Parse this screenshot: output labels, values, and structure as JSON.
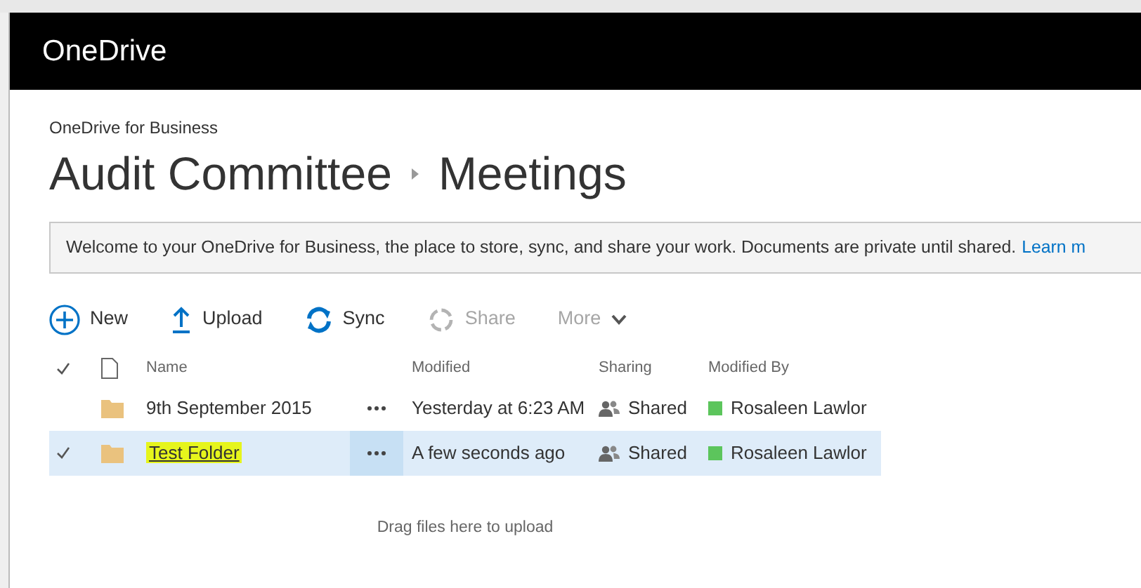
{
  "app": {
    "title": "OneDrive"
  },
  "breadcrumb": {
    "site": "OneDrive for Business",
    "path": [
      "Audit Committee",
      "Meetings"
    ]
  },
  "banner": {
    "text": "Welcome to your OneDrive for Business, the place to store, sync, and share your work. Documents are private until shared.",
    "link": "Learn m"
  },
  "toolbar": [
    {
      "kind": "new",
      "label": "New",
      "disabled": false
    },
    {
      "kind": "upload",
      "label": "Upload",
      "disabled": false
    },
    {
      "kind": "sync",
      "label": "Sync",
      "disabled": false
    },
    {
      "kind": "share",
      "label": "Share",
      "disabled": true
    },
    {
      "kind": "more",
      "label": "More",
      "disabled": true
    }
  ],
  "table": {
    "columns": [
      "Name",
      "Modified",
      "Sharing",
      "Modified By"
    ],
    "rows": [
      {
        "name": "9th September 2015",
        "selected": false,
        "highlighted": false,
        "modified": "Yesterday at 6:23 AM",
        "sharing": "Shared",
        "modified_by": "Rosaleen Lawlor",
        "color": "#5cc55c"
      },
      {
        "name": "Test Folder",
        "selected": true,
        "highlighted": true,
        "modified": "A few seconds ago",
        "sharing": "Shared",
        "modified_by": "Rosaleen Lawlor",
        "color": "#5cc55c"
      }
    ]
  },
  "drop_hint": "Drag files here to upload"
}
